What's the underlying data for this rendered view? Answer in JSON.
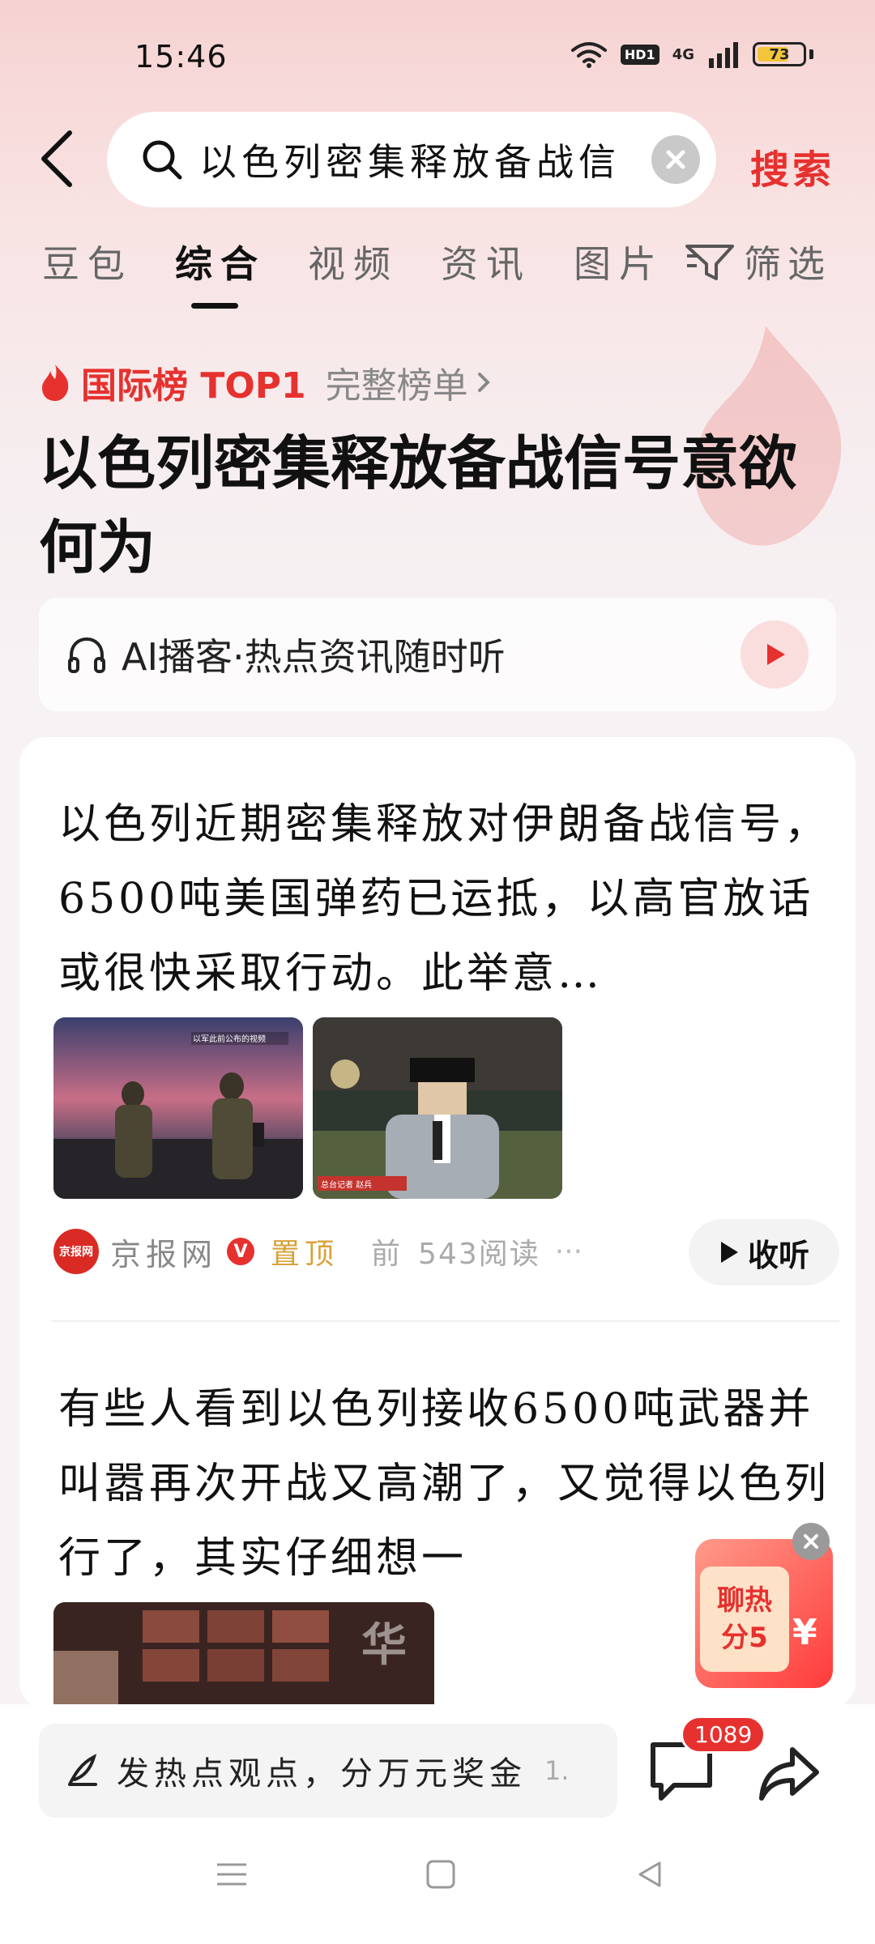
{
  "status_bar": {
    "time": "15:46",
    "hd_label": "HD1",
    "network_label": "4G",
    "battery_level": 73,
    "battery_text": "73"
  },
  "search": {
    "query": "以色列密集释放备战信",
    "action_label": "搜索"
  },
  "tabs": [
    {
      "label": "豆包",
      "active": false
    },
    {
      "label": "综合",
      "active": true
    },
    {
      "label": "视频",
      "active": false
    },
    {
      "label": "资讯",
      "active": false
    },
    {
      "label": "图片",
      "active": false
    }
  ],
  "filter_label": "筛选",
  "rank": {
    "label": "国际榜 TOP1",
    "more_label": "完整榜单"
  },
  "headline": "以色列密集释放备战信号意欲何为",
  "podcast": {
    "label": "AI播客·热点资讯随时听"
  },
  "articles": [
    {
      "text": "以色列近期密集释放对伊朗备战信号，6500吨美国弹药已运抵，以高官放话或很快采取行动。此举意…",
      "thumb1_caption": "以军此前公布的视频",
      "thumb2_caption": "总台记者 赵兵",
      "source": "京报网",
      "source_logo_text": "京报网",
      "pin_label": "置顶",
      "time_ago": "前",
      "reads": "543阅读",
      "listen_label": "收听"
    },
    {
      "text": "有些人看到以色列接收6500吨武器并叫嚣再次开战又高潮了，又觉得以色列行了，其实仔细想一",
      "thumb_caption": "华"
    }
  ],
  "float_ad": {
    "line1": "聊热",
    "line2": "分5",
    "yen": "¥"
  },
  "bottom_bar": {
    "comment_placeholder": "发热点观点，分万元奖金",
    "comment_suffix": "1.",
    "comment_count": "1089"
  },
  "colors": {
    "accent": "#e6312f",
    "pin": "#d8a13a"
  }
}
